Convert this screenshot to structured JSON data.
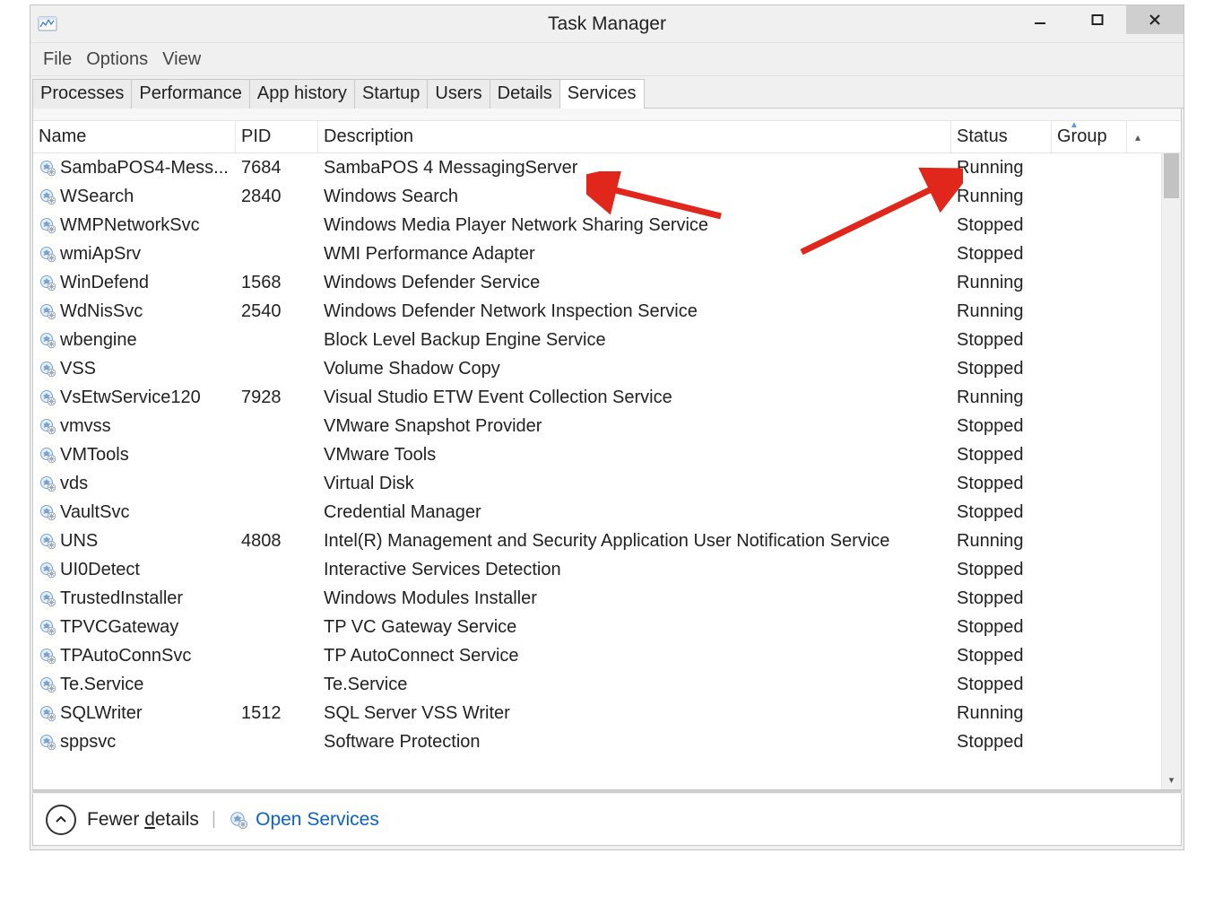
{
  "window": {
    "title": "Task Manager"
  },
  "menu": {
    "file": "File",
    "options": "Options",
    "view": "View"
  },
  "tabs": {
    "processes": "Processes",
    "performance": "Performance",
    "app_history": "App history",
    "startup": "Startup",
    "users": "Users",
    "details": "Details",
    "services": "Services"
  },
  "columns": {
    "name": "Name",
    "pid": "PID",
    "description": "Description",
    "status": "Status",
    "group": "Group"
  },
  "services": [
    {
      "name": "SambaPOS4-Mess...",
      "pid": "7684",
      "description": "SambaPOS 4 MessagingServer",
      "status": "Running",
      "group": ""
    },
    {
      "name": "WSearch",
      "pid": "2840",
      "description": "Windows Search",
      "status": "Running",
      "group": ""
    },
    {
      "name": "WMPNetworkSvc",
      "pid": "",
      "description": "Windows Media Player Network Sharing Service",
      "status": "Stopped",
      "group": ""
    },
    {
      "name": "wmiApSrv",
      "pid": "",
      "description": "WMI Performance Adapter",
      "status": "Stopped",
      "group": ""
    },
    {
      "name": "WinDefend",
      "pid": "1568",
      "description": "Windows Defender Service",
      "status": "Running",
      "group": ""
    },
    {
      "name": "WdNisSvc",
      "pid": "2540",
      "description": "Windows Defender Network Inspection Service",
      "status": "Running",
      "group": ""
    },
    {
      "name": "wbengine",
      "pid": "",
      "description": "Block Level Backup Engine Service",
      "status": "Stopped",
      "group": ""
    },
    {
      "name": "VSS",
      "pid": "",
      "description": "Volume Shadow Copy",
      "status": "Stopped",
      "group": ""
    },
    {
      "name": "VsEtwService120",
      "pid": "7928",
      "description": "Visual Studio ETW Event Collection Service",
      "status": "Running",
      "group": ""
    },
    {
      "name": "vmvss",
      "pid": "",
      "description": "VMware Snapshot Provider",
      "status": "Stopped",
      "group": ""
    },
    {
      "name": "VMTools",
      "pid": "",
      "description": "VMware Tools",
      "status": "Stopped",
      "group": ""
    },
    {
      "name": "vds",
      "pid": "",
      "description": "Virtual Disk",
      "status": "Stopped",
      "group": ""
    },
    {
      "name": "VaultSvc",
      "pid": "",
      "description": "Credential Manager",
      "status": "Stopped",
      "group": ""
    },
    {
      "name": "UNS",
      "pid": "4808",
      "description": "Intel(R) Management and Security Application User Notification Service",
      "status": "Running",
      "group": ""
    },
    {
      "name": "UI0Detect",
      "pid": "",
      "description": "Interactive Services Detection",
      "status": "Stopped",
      "group": ""
    },
    {
      "name": "TrustedInstaller",
      "pid": "",
      "description": "Windows Modules Installer",
      "status": "Stopped",
      "group": ""
    },
    {
      "name": "TPVCGateway",
      "pid": "",
      "description": "TP VC Gateway Service",
      "status": "Stopped",
      "group": ""
    },
    {
      "name": "TPAutoConnSvc",
      "pid": "",
      "description": "TP AutoConnect Service",
      "status": "Stopped",
      "group": ""
    },
    {
      "name": "Te.Service",
      "pid": "",
      "description": "Te.Service",
      "status": "Stopped",
      "group": ""
    },
    {
      "name": "SQLWriter",
      "pid": "1512",
      "description": "SQL Server VSS Writer",
      "status": "Running",
      "group": ""
    },
    {
      "name": "sppsvc",
      "pid": "",
      "description": "Software Protection",
      "status": "Stopped",
      "group": ""
    }
  ],
  "bottom": {
    "fewer_details_pre": "Fewer ",
    "fewer_details_ul": "d",
    "fewer_details_post": "etails",
    "open_services": "Open Services"
  }
}
